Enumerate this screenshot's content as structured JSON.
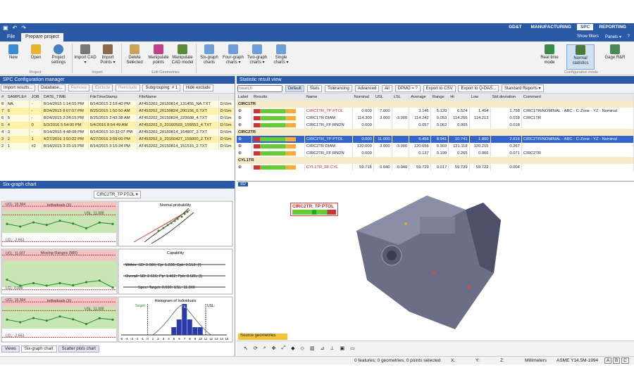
{
  "mode_tabs": [
    {
      "label": "GD&T"
    },
    {
      "label": "MANUFACTURING"
    },
    {
      "label": "SPC"
    },
    {
      "label": "REPORTING"
    }
  ],
  "window_right": {
    "show_filters": "Show filters",
    "panels": "Panels ▾",
    "help": "?"
  },
  "ribbon_tabs": [
    {
      "label": "File"
    },
    {
      "label": "Prepare project"
    }
  ],
  "ribbon_buttons": [
    {
      "label": "New"
    },
    {
      "label": "Open"
    },
    {
      "label": "Project settings"
    },
    {
      "label": "Import CAD ▾"
    },
    {
      "label": "Import Points ▾"
    },
    {
      "label": "Delete Selected"
    },
    {
      "label": "Manipulate points"
    },
    {
      "label": "Manipulate CAD model"
    },
    {
      "label": "Six-graph charts"
    },
    {
      "label": "Four-graph charts ▾"
    },
    {
      "label": "Two-graph charts ▾"
    },
    {
      "label": "Single charts ▾"
    },
    {
      "label": "Real time mode"
    },
    {
      "label": "Normal statistics"
    },
    {
      "label": "Gage R&R"
    }
  ],
  "ribbon_groups": [
    {
      "label": "Project"
    },
    {
      "label": "Import"
    },
    {
      "label": "Edit Geometries"
    },
    {
      "label": "Configuration mode"
    }
  ],
  "spc_panel": {
    "title": "SPC Configuration manager",
    "buttons": [
      "Import results...",
      "Database...",
      "Remove",
      "Exclude",
      "Reinclude"
    ],
    "subgrouping": "Subgrouping: # 1",
    "hide_excluded": "Hide exclude",
    "columns": [
      "#",
      "SAMPLE#",
      "JOB",
      "DATE_TIME",
      "FileTimeStamp",
      "FileName",
      ""
    ],
    "rows": [
      [
        "8",
        "NA",
        "-",
        "8/14/2015 1:14:55 PM",
        "8/14/2015 2:19:40 PM",
        "AT453202_20150814_131455_NA.TXT",
        "D:\\Sm"
      ],
      [
        "7",
        "6",
        "-",
        "8/24/2015 8:07:57 PM",
        "8/25/2015 1:50:50 AM",
        "AT453202_20150824_200156_6.TXT",
        "D:\\Sm"
      ],
      [
        "6",
        "5",
        "-",
        "8/24/2015 2:24:15 PM",
        "8/25/2015 2:43:38 AM",
        "AT453202_20150824_223608_4.TXT",
        "D:\\Sm"
      ],
      [
        "5",
        "4",
        "0",
        "5/3/2016 5:54:00 PM",
        "5/4/2016 8:54:49 AM",
        "AT453202_0_20160503_155553_4.TXT",
        "D:\\Sm"
      ],
      [
        "4",
        "3",
        "-",
        "8/14/2015 4:48:08 PM",
        "8/14/2015 10:32:07 PM",
        "AT453202_20150814_164807_3.TXT",
        "D:\\Sm"
      ],
      [
        "3",
        "2",
        "1",
        "4/27/2016 3:50:22 PM",
        "4/27/2016 3:59:00 PM",
        "AT453202_0_20160427_155000_2.TXT",
        "D:\\Sm"
      ],
      [
        "2",
        "1",
        "#2",
        "8/14/2015 3:15:15 PM",
        "8/14/2015 3:15:24 PM",
        "AT453202_20150814_151515_2.TXT",
        "D:\\Sm"
      ]
    ]
  },
  "six_graph": {
    "title": "Six-graph chart",
    "selected": "CIRC2TR_TP PTOL",
    "individuals_title": "Individuals (X)",
    "moving_title": "Moving Ranges (MR)",
    "individuals2_title": "Individuals (X)",
    "normal_title": "Normal probability",
    "capability_title": "Capability",
    "histogram_title": "Histogram of Individuals",
    "ucl1": "UCL: 15.364",
    "usl1": "USL: 11.000",
    "lcl1": "LCL: -2.563",
    "ucl2": "UCL: 11.007",
    "lcl2": "LCL: 0.000",
    "ucl3": "UCL: 15.364",
    "usl3": "USL: 11.000",
    "lcl3": "LCL: -2.563",
    "within": "Within: SD: 2.986; Cp: 1.228; Cpk: 0.513; (I)",
    "overall": "Overall: SD: 2.616; Pp: 1.402; Ppk: 0.585; (I)",
    "spec": "Spec: Target: 0.000; USL: 11.000",
    "target_label": "Target:",
    "usl_label": "USL:",
    "hist_peak": "4",
    "hist_axis": [
      "-5",
      "-4",
      "-3",
      "-2",
      "-1",
      "0",
      "1",
      "2",
      "3",
      "4",
      "5",
      "6",
      "7",
      "8",
      "9",
      "10",
      "11",
      "12",
      "13",
      "14",
      "15"
    ],
    "tabs": [
      "Views",
      "Six-graph chart",
      "Scatter plots chart"
    ]
  },
  "stat_panel": {
    "title": "Statistic result view",
    "search_placeholder": "Search",
    "filters": [
      "Default",
      "Stats",
      "Tolerancing",
      "Advanced",
      "All"
    ],
    "dpmo": "DPMO = ?",
    "export_csv": "Export to CSV",
    "export_qdas": "Export to Q-DAS...",
    "reports": "Standard Reports ▾",
    "columns": [
      "Label",
      "Results",
      "Name",
      "Nominal",
      "USL",
      "LSL",
      "Average",
      "Range",
      "Hi",
      "Low",
      "Std.deviation",
      "Comment"
    ],
    "groups": [
      {
        "name": "CIRC1TR",
        "rows": [
          [
            "CIRC1TR_TP PTOL",
            "0.000",
            "7.000",
            "",
            "3.146",
            "5.120",
            "6.574",
            "1.454",
            "1.758",
            "CIRC1TR/NOMINAL - ABC - C-Zone - YZ - Nominal"
          ],
          [
            "CIRC1TR DIAM",
            "114.300",
            "3.000",
            "-3.000",
            "114.242",
            "0.053",
            "114.266",
            "114.213",
            "0.018",
            "CIRC1TR"
          ],
          [
            "CIRC1TR_FF RNDN",
            "0.000",
            "",
            "",
            "0.057",
            "0.062",
            "0.005",
            "",
            "0.018",
            ""
          ]
        ]
      },
      {
        "name": "CIRC2TR",
        "rows": [
          [
            "CIRC2TR_TP PTOL",
            "0.000",
            "11.000",
            "",
            "6.456",
            "8.941",
            "10.741",
            "1.800",
            "2.616",
            "CIRC2TR/NOMINAL - ABC - C-Zone - YZ - Nominal"
          ],
          [
            "CIRC2TR DIAM",
            "120.000",
            "3.000",
            "-3.000",
            "120.656",
            "0.903",
            "121.118",
            "120.215",
            "0.267",
            ""
          ],
          [
            "CIRC2TR_FF RNDN",
            "0.000",
            "",
            "",
            "0.137",
            "0.199",
            "0.265",
            "0.066",
            "0.071",
            "CIRC2TR"
          ]
        ]
      },
      {
        "name": "CYL1TR",
        "rows": [
          [
            "CYL1TR_FF CYL",
            "59.715",
            "0.040",
            "-0.040",
            "59.729",
            "0.017",
            "59.739",
            "59.722",
            "0.004",
            ""
          ]
        ]
      }
    ]
  },
  "view3d": {
    "label": "3D",
    "callout": "CIRC2TR_TP PTOL",
    "source_tab": "Source geometries"
  },
  "status": {
    "features": "0 features; 0 geometries; 0 points selected",
    "x": "X:",
    "y": "Y:",
    "z": "Z:",
    "units": "Millimeters",
    "standard": "ASME Y14.5M-1994",
    "abc": [
      "A",
      "B",
      "C"
    ]
  },
  "colors": {
    "accent": "#2a5aa6",
    "spc_bg": "#2a5aa6",
    "green_zone": "#c8e6b4",
    "red_zone": "#f2c4c4",
    "selection": "#3366cc"
  },
  "chart_data": {
    "type": "line",
    "individuals": [
      6.4,
      5.1,
      7.2,
      5.9,
      8.0,
      6.6,
      4.2,
      7.1,
      6.4
    ],
    "moving_range": [
      3.2,
      1.3,
      2.1,
      1.3,
      2.1,
      1.4,
      2.4,
      2.9,
      0.7
    ],
    "histogram": {
      "bins": [
        5,
        6,
        7,
        8,
        9,
        10
      ],
      "counts": [
        1,
        2,
        4,
        2,
        1,
        1
      ]
    },
    "ylim_individuals": [
      -3.5,
      16.5
    ],
    "ylim_mr": [
      -0.5,
      12
    ]
  }
}
